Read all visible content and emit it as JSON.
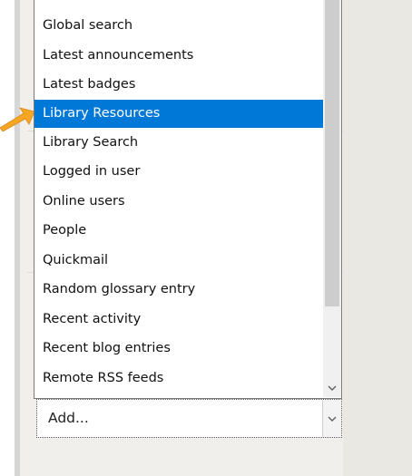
{
  "dropdown": {
    "items": [
      {
        "label": "Global search"
      },
      {
        "label": "Latest announcements"
      },
      {
        "label": "Latest badges"
      },
      {
        "label": "Library Resources"
      },
      {
        "label": "Library Search"
      },
      {
        "label": "Logged in user"
      },
      {
        "label": "Online users"
      },
      {
        "label": "People"
      },
      {
        "label": "Quickmail"
      },
      {
        "label": "Random glossary entry"
      },
      {
        "label": "Recent activity"
      },
      {
        "label": "Recent blog entries"
      },
      {
        "label": "Remote RSS feeds"
      }
    ],
    "selected_index": 3
  },
  "select": {
    "value": "Add..."
  },
  "colors": {
    "selection": "#0078d7",
    "pointer": "#f5a623",
    "panel": "#f0efec"
  },
  "icons": {
    "pointer": "arrow-pointer-icon",
    "scroll_down": "chevron-down-icon",
    "select_arrow": "chevron-down-icon"
  }
}
